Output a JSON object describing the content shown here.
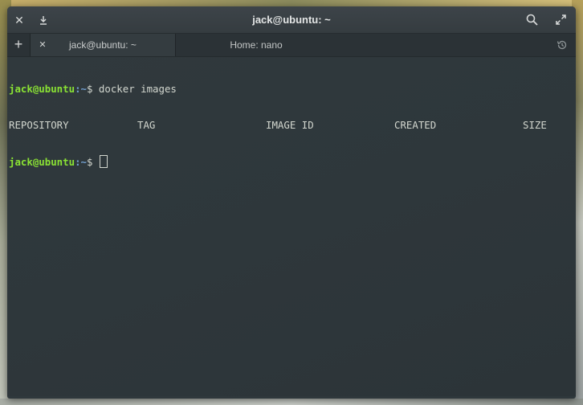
{
  "window": {
    "title": "jack@ubuntu: ~"
  },
  "tabs": [
    {
      "label": "jack@ubuntu: ~",
      "active": true
    },
    {
      "label": "Home: nano",
      "active": false
    }
  ],
  "icons": {
    "close": "close-icon",
    "download": "download-icon",
    "search": "search-icon",
    "maximize": "maximize-icon",
    "add_tab": "plus-icon",
    "tab_close": "close-icon",
    "history": "history-icon"
  },
  "terminal": {
    "prompt_user": "jack@ubuntu",
    "prompt_path": ":~",
    "prompt_symbol": "$",
    "command1": " docker images",
    "headers": [
      "REPOSITORY",
      "TAG",
      "IMAGE ID",
      "CREATED",
      "SIZE"
    ]
  },
  "colors": {
    "prompt_user": "#8ae234",
    "prompt_path": "#729fcf",
    "text": "#d3d7cf",
    "background": "#2f383c"
  }
}
